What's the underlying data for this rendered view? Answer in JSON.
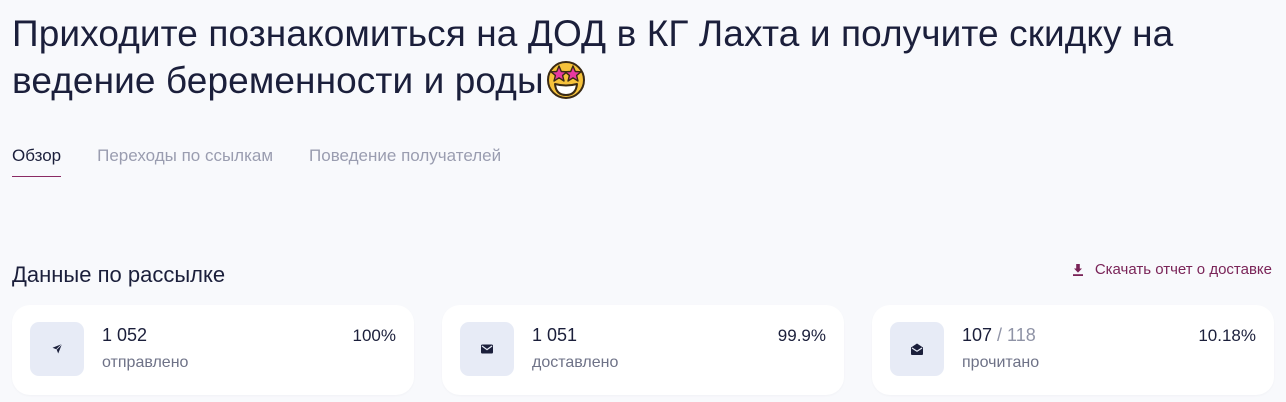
{
  "header": {
    "title": "Приходите познакомиться на ДОД в КГ Лахта и получите скидку на ведение беременности и роды",
    "title_emoji": "star-struck-emoji"
  },
  "tabs": [
    {
      "label": "Обзор",
      "active": true
    },
    {
      "label": "Переходы по ссылкам",
      "active": false
    },
    {
      "label": "Поведение получателей",
      "active": false
    }
  ],
  "section": {
    "title": "Данные по рассылке",
    "download_label": "Скачать отчет о доставке",
    "download_icon": "download-icon"
  },
  "stats": [
    {
      "icon": "send-icon",
      "value": "1 052",
      "total": "",
      "label": "отправлено",
      "percent": "100%"
    },
    {
      "icon": "envelope-icon",
      "value": "1 051",
      "total": "",
      "label": "доставлено",
      "percent": "99.9%"
    },
    {
      "icon": "open-envelope-icon",
      "value": "107",
      "total": " / 118",
      "label": "прочитано",
      "percent": "10.18%"
    }
  ],
  "colors": {
    "accent": "#7a2458",
    "text": "#1b1f3b",
    "muted": "#9a9db0",
    "icon_bg": "#e7ebf6",
    "background": "#f8f9fc"
  }
}
